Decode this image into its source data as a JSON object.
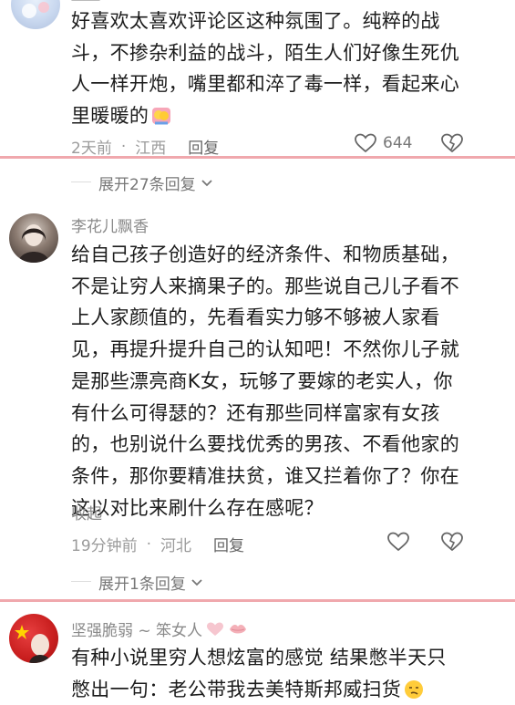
{
  "comment1": {
    "text_lines": [
      "好喜欢太喜欢评论区这种氛围了。纯粹的战",
      "斗，不掺杂利益的战斗，陌生人们好像生死仇",
      "人一样开炮，嘴里都和淬了毒一样，看起来心",
      "里暖暖的"
    ],
    "time": "2天前",
    "location": "江西",
    "reply_label": "回复",
    "like_count": "644"
  },
  "expand1": {
    "label": "展开27条回复"
  },
  "comment2": {
    "username": "李花儿飘香",
    "text_lines": [
      "给自己孩子创造好的经济条件、和物质基础，",
      "不是让穷人来摘果子的。那些说自己儿子看不",
      "上人家颜值的，先看看实力够不够被人家看",
      "见，再提升提升自己的认知吧！不然你儿子就",
      "是那些漂亮商K女，玩够了要嫁的老实人，你",
      "有什么可得瑟的？还有那些同样富家有女孩",
      "的，也别说什么要找优秀的男孩、不看他家的",
      "条件，那你要精准扶贫，谁又拦着你了？你在",
      "这以对比来刷什么存在感呢？"
    ],
    "collapse_label": "收起",
    "time": "19分钟前",
    "location": "河北",
    "reply_label": "回复"
  },
  "expand2": {
    "label": "展开1条回复"
  },
  "comment3": {
    "username": "坚强脆弱 ~ 笨女人",
    "text_lines": [
      "有种小说里穷人想炫富的感觉 结果憋半天只",
      "憋出一句：老公带我去美特斯邦威扫货"
    ]
  },
  "colors": {
    "separator": "#f0a8ad",
    "body_text": "#1c1c1c",
    "meta_text": "#9b9b9b"
  }
}
